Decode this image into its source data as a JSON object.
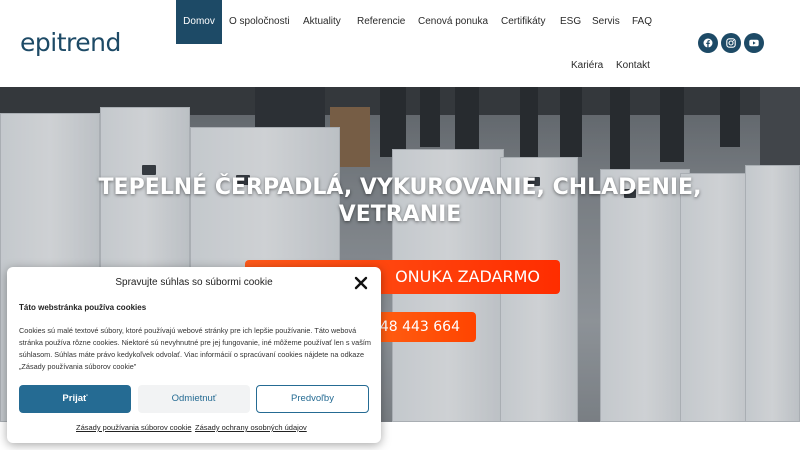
{
  "header": {
    "logo": "epitrend",
    "nav": [
      {
        "label": "Domov",
        "active": true
      },
      {
        "label": "O spoločnosti"
      },
      {
        "label": "Aktuality"
      },
      {
        "label": "Referencie"
      },
      {
        "label": "Cenová ponuka"
      },
      {
        "label": "Certifikáty"
      },
      {
        "label": "ESG"
      },
      {
        "label": "Servis"
      },
      {
        "label": "FAQ"
      },
      {
        "label": "Kariéra"
      },
      {
        "label": "Kontakt"
      }
    ],
    "social": [
      "facebook-icon",
      "instagram-icon",
      "youtube-icon"
    ]
  },
  "hero": {
    "title": "TEPELNÉ ČERPADLÁ, VYKUROVANIE, CHLADENIE, VETRANIE",
    "cta_offer": "ONUKA ZADARMO",
    "cta_phone": "48 443 664"
  },
  "cookie": {
    "title": "Spravujte súhlas so súbormi cookie",
    "subtitle": "Táto webstránka používa cookies",
    "text": "Cookies sú malé textové súbory, ktoré používajú webové stránky pre ich lepšie používanie. Táto webová stránka používa rôzne cookies. Niektoré sú nevyhnutné pre jej fungovanie, iné môžeme používať len s vaším súhlasom. Súhlas máte právo kedykoľvek odvolať. Viac informácií o spracúvaní cookies nájdete na odkaze „Zásady používania súborov cookie\"",
    "accept": "Prijať",
    "deny": "Odmietnuť",
    "prefs": "Predvoľby",
    "link_cookies": "Zásady používania súborov cookie",
    "link_privacy": "Zásady ochrany osobných údajov"
  },
  "colors": {
    "brand": "#1d4a66",
    "button": "#256b93",
    "cta": "#ff4a10"
  }
}
